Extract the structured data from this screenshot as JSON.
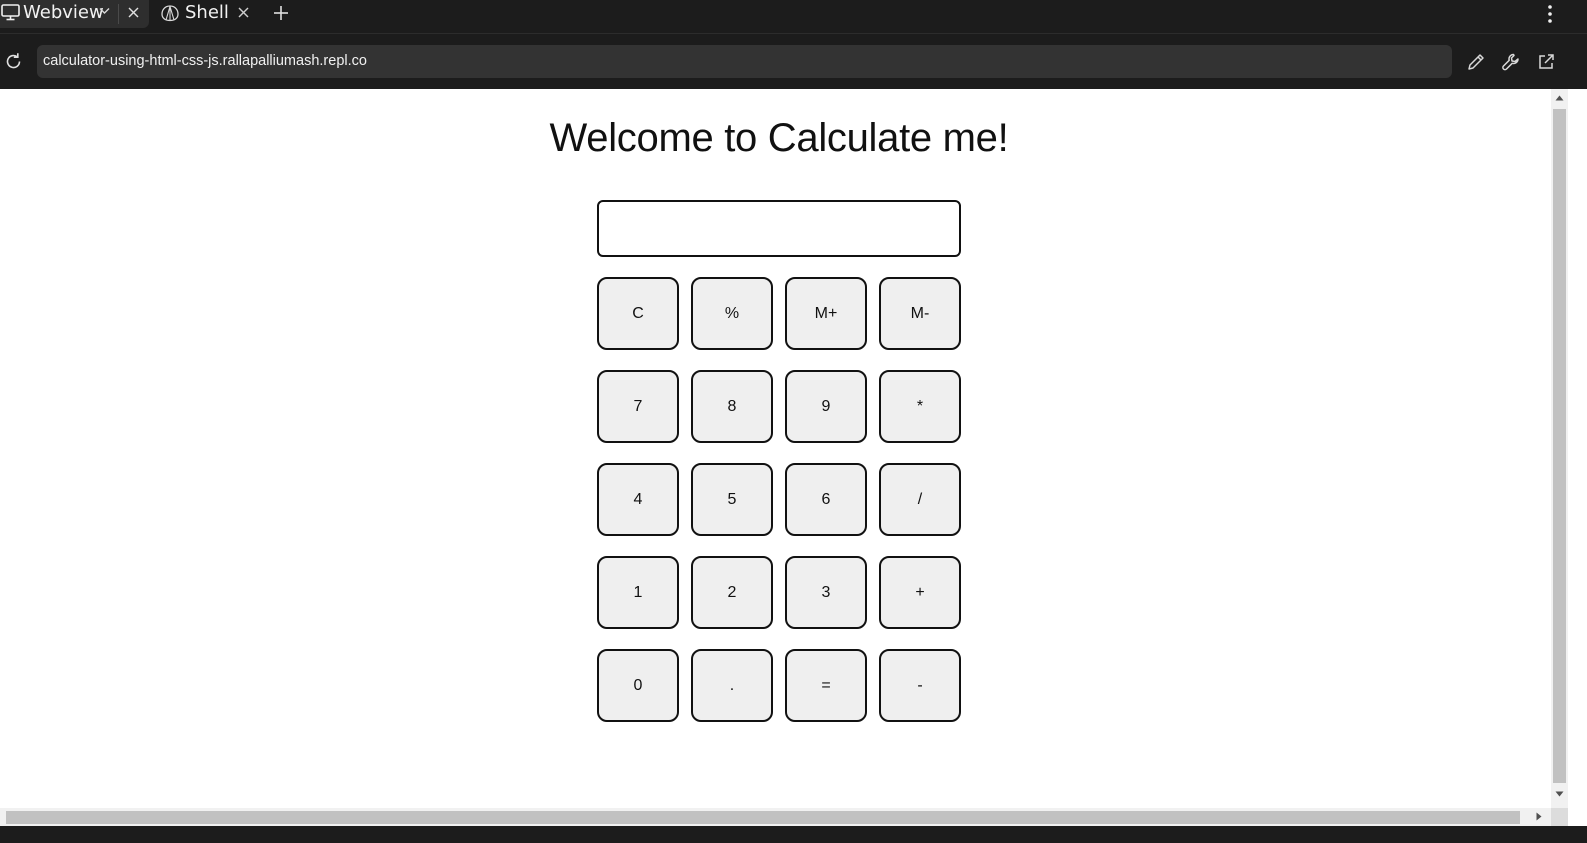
{
  "tabs": [
    {
      "label": "Webview",
      "icon": "monitor-icon",
      "active": true
    },
    {
      "label": "Shell",
      "icon": "shell-icon",
      "active": false
    }
  ],
  "address_bar": {
    "url": "calculator-using-html-css-js.rallapalliumash.repl.co"
  },
  "page": {
    "title": "Welcome to Calculate me!",
    "display_value": ""
  },
  "keypad": {
    "rows": [
      [
        "C",
        "%",
        "M+",
        "M-"
      ],
      [
        "7",
        "8",
        "9",
        "*"
      ],
      [
        "4",
        "5",
        "6",
        "/"
      ],
      [
        "1",
        "2",
        "3",
        "+"
      ],
      [
        "0",
        ".",
        "=",
        "-"
      ]
    ]
  },
  "colors": {
    "chrome_bg": "#1c1c1c",
    "active_tab_bg": "#2e2e2e",
    "url_field_bg": "#333333",
    "key_bg": "#efefef",
    "key_border": "#111111"
  }
}
